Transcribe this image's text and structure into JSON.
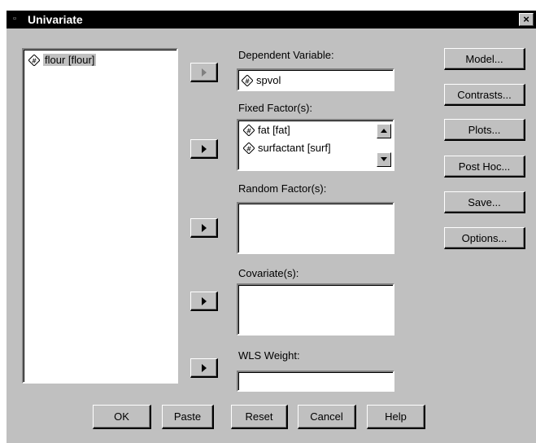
{
  "window": {
    "title": "Univariate",
    "close_glyph": "×"
  },
  "source_list": {
    "items": [
      {
        "label": "flour [flour]",
        "icon": "scale-variable-icon"
      }
    ]
  },
  "dependent": {
    "label": "Dependent Variable:",
    "value": "spvol"
  },
  "fixed": {
    "label": "Fixed Factor(s):",
    "items": [
      "fat [fat]",
      "surfactant [surf]"
    ]
  },
  "random": {
    "label": "Random Factor(s):"
  },
  "covariates": {
    "label": "Covariate(s):"
  },
  "wls": {
    "label": "WLS Weight:"
  },
  "side_buttons": {
    "model": "Model...",
    "contrasts": "Contrasts...",
    "plots": "Plots...",
    "posthoc": "Post Hoc...",
    "save": "Save...",
    "options": "Options..."
  },
  "bottom_buttons": {
    "ok": "OK",
    "paste": "Paste",
    "reset": "Reset",
    "cancel": "Cancel",
    "help": "Help"
  },
  "colors": {
    "dialog_bg": "#c0c0c0",
    "titlebar": "#000000"
  }
}
